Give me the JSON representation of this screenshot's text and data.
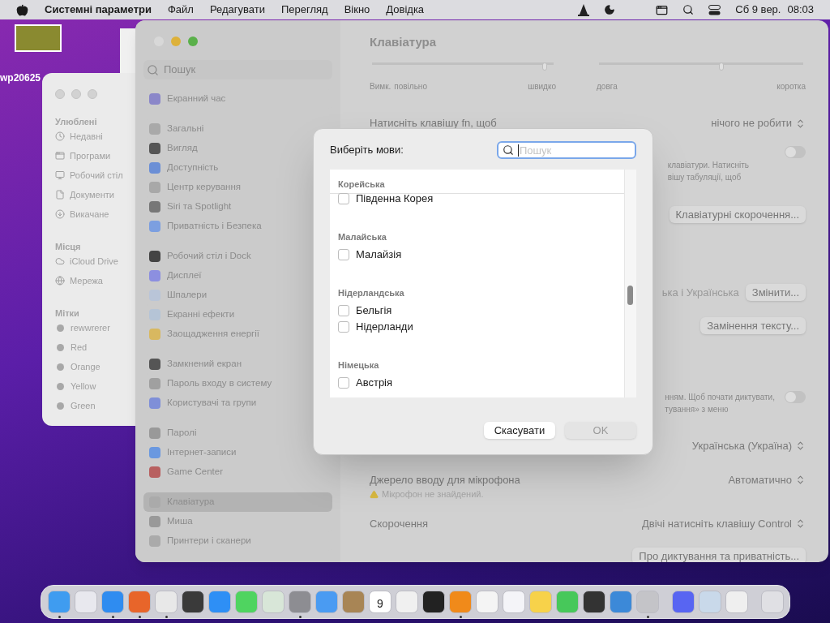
{
  "menubar": {
    "app_name": "Системні параметри",
    "menus": [
      "Файл",
      "Редагувати",
      "Перегляд",
      "Вікно",
      "Довідка"
    ],
    "date": "Сб 9 вер.",
    "time": "08:03"
  },
  "desktop_icon": {
    "label": "wp20625"
  },
  "finder": {
    "sections": [
      {
        "title": "Улюблені",
        "items": [
          "Недавні",
          "Програми",
          "Робочий стіл",
          "Документи",
          "Викачане"
        ]
      },
      {
        "title": "Місця",
        "items": [
          "iCloud Drive",
          "Мережа"
        ]
      },
      {
        "title": "Мітки",
        "items": [
          "rewwrerer",
          "Red",
          "Orange",
          "Yellow",
          "Green"
        ]
      }
    ]
  },
  "settings": {
    "title": "Клавіатура",
    "search": {
      "placeholder": "Пошук"
    },
    "sidebar": [
      [
        {
          "label": "Екранний час",
          "selected": false
        }
      ],
      [
        {
          "label": "Загальні",
          "selected": false
        },
        {
          "label": "Вигляд",
          "selected": false
        },
        {
          "label": "Доступність",
          "selected": false
        },
        {
          "label": "Центр керування",
          "selected": false
        },
        {
          "label": "Siri та Spotlight",
          "selected": false
        },
        {
          "label": "Приватність і Безпека",
          "selected": false
        }
      ],
      [
        {
          "label": "Робочий стіл і Dock",
          "selected": false
        },
        {
          "label": "Дисплеї",
          "selected": false
        },
        {
          "label": "Шпалери",
          "selected": false
        },
        {
          "label": "Екранні ефекти",
          "selected": false
        },
        {
          "label": "Заощадження енергії",
          "selected": false
        }
      ],
      [
        {
          "label": "Замкнений екран",
          "selected": false
        },
        {
          "label": "Пароль входу в систему",
          "selected": false
        },
        {
          "label": "Користувачі та групи",
          "selected": false
        }
      ],
      [
        {
          "label": "Паролі",
          "selected": false
        },
        {
          "label": "Інтернет-записи",
          "selected": false
        },
        {
          "label": "Game Center",
          "selected": false
        }
      ],
      [
        {
          "label": "Клавіатура",
          "selected": true
        },
        {
          "label": "Миша",
          "selected": false
        },
        {
          "label": "Принтери і сканери",
          "selected": false
        }
      ]
    ],
    "sliders": [
      {
        "level": 0.95,
        "min_labels": [
          "Вимк.",
          "повільно"
        ],
        "max_label": "швидко"
      },
      {
        "level": 0.6,
        "min_labels": [
          "довга"
        ],
        "max_label": "коротка"
      }
    ],
    "fn_row": {
      "label": "Натисніть клавішу fn, щоб",
      "value": "нічого не робити"
    },
    "nav_row": {
      "text_lines": [
        "клавіатури. Натисніть",
        "вішу табуляції, щоб"
      ],
      "on": false
    },
    "shortcuts_button": "Клавіатурні скорочення...",
    "input_row": {
      "text": "ька і Українська",
      "button": "Змінити..."
    },
    "replace_button": "Замінення тексту...",
    "dictation_row": {
      "text_lines": [
        "нням. Щоб почати диктувати,",
        "тування» з меню"
      ],
      "on": false
    },
    "language_value": "Українська (Україна)",
    "mic_row": {
      "label": "Джерело вводу для мікрофона",
      "value": "Автоматично",
      "warning": "Мікрофон не знайдений."
    },
    "shortcut_row": {
      "label": "Скорочення",
      "value": "Двічі натисніть клавішу Control"
    },
    "privacy_button": "Про диктування та приватність..."
  },
  "dialog": {
    "title": "Виберіть мови:",
    "search": {
      "placeholder": "Пошук"
    },
    "groups": [
      {
        "header": "Корейська",
        "items": [
          {
            "label": "Південна Корея",
            "checked": false
          }
        ]
      },
      {
        "header": "Малайська",
        "items": [
          {
            "label": "Малайзія",
            "checked": false
          }
        ]
      },
      {
        "header": "Нідерландська",
        "items": [
          {
            "label": "Бельгія",
            "checked": false
          },
          {
            "label": "Нідерланди",
            "checked": false
          }
        ]
      },
      {
        "header": "Німецька",
        "items": [
          {
            "label": "Австрія",
            "checked": false
          }
        ]
      }
    ],
    "buttons": [
      {
        "label": "Скасувати",
        "disabled": false
      },
      {
        "label": "OK",
        "disabled": true
      }
    ]
  },
  "dock": [
    {
      "kind": "finder",
      "running": true
    },
    {
      "kind": "launchpad",
      "running": false
    },
    {
      "kind": "safari",
      "running": true
    },
    {
      "kind": "firefox",
      "running": true
    },
    {
      "kind": "chrome",
      "running": true
    },
    {
      "kind": "guitar",
      "running": false
    },
    {
      "kind": "appstore",
      "running": false
    },
    {
      "kind": "messages",
      "running": false
    },
    {
      "kind": "maps",
      "running": false
    },
    {
      "kind": "settings",
      "running": true
    },
    {
      "kind": "mail",
      "running": false
    },
    {
      "kind": "contacts",
      "running": false
    },
    {
      "kind": "calendar",
      "running": false,
      "text": "9"
    },
    {
      "kind": "textedit",
      "running": false
    },
    {
      "kind": "terminal",
      "running": false
    },
    {
      "kind": "vlc",
      "running": true
    },
    {
      "kind": "reminders",
      "running": false
    },
    {
      "kind": "vscode",
      "running": false
    },
    {
      "kind": "notes",
      "running": false
    },
    {
      "kind": "facetime",
      "running": false
    },
    {
      "kind": "quicktime",
      "running": false
    },
    {
      "kind": "blue",
      "running": false
    },
    {
      "kind": "grey",
      "running": true
    },
    {
      "kind": "separator"
    },
    {
      "kind": "discord",
      "running": false
    },
    {
      "kind": "preview",
      "running": false
    },
    {
      "kind": "printer",
      "running": false
    },
    {
      "kind": "separator"
    },
    {
      "kind": "trash",
      "running": false
    }
  ]
}
